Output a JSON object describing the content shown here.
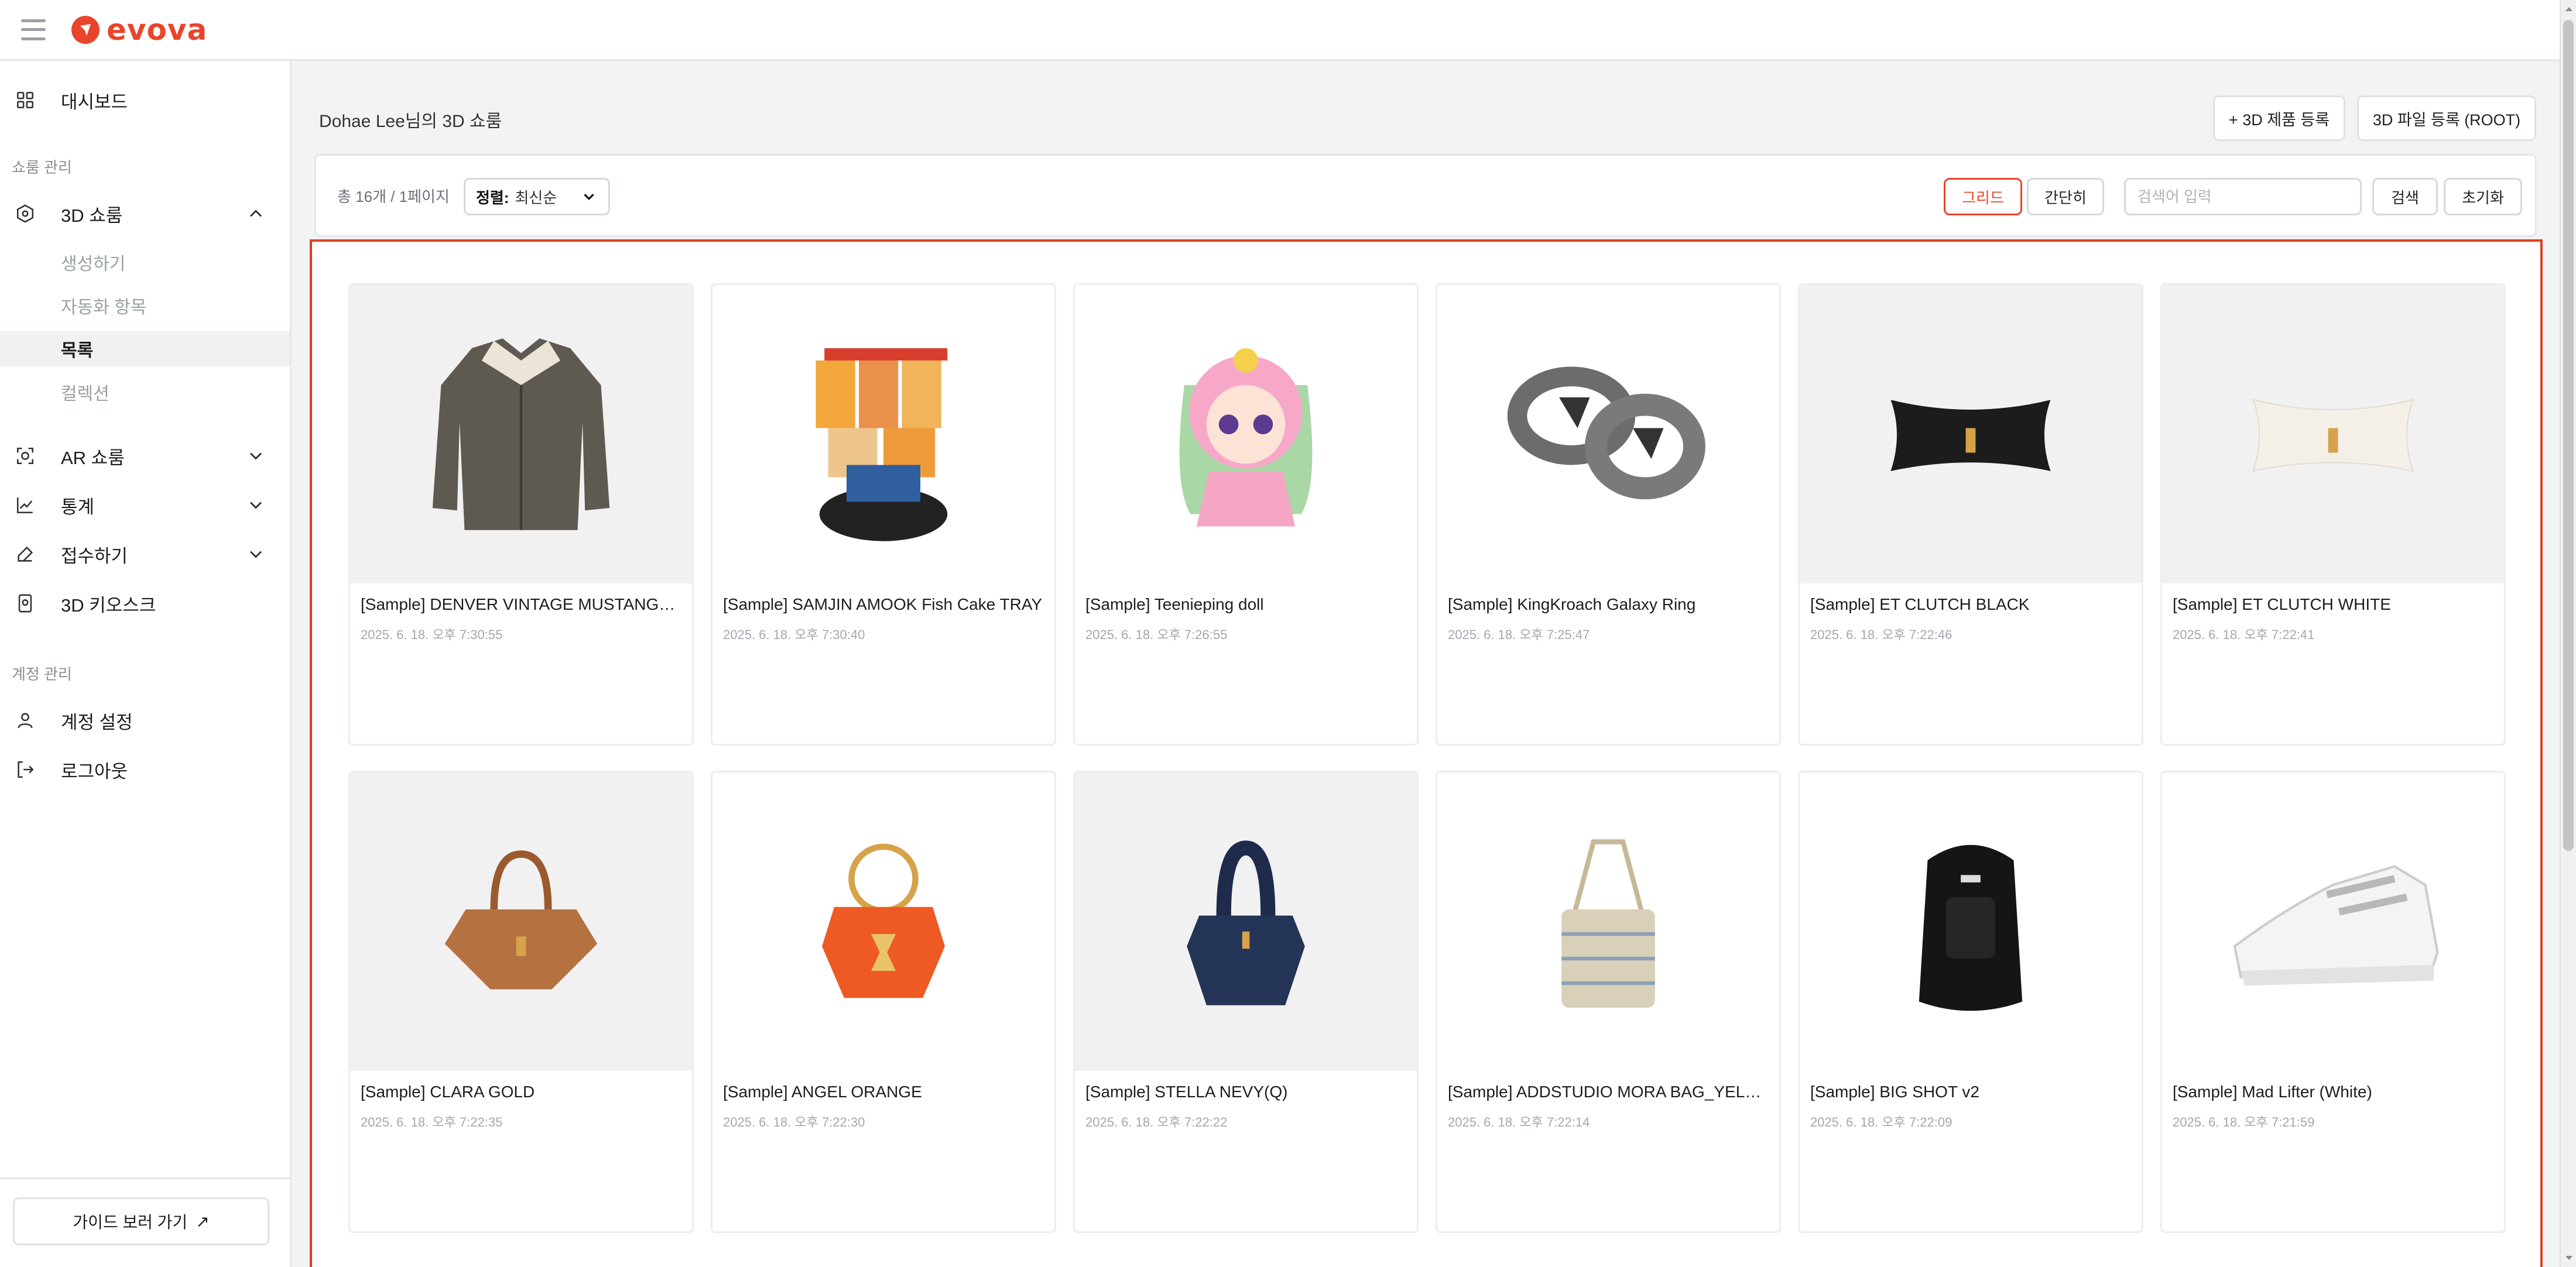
{
  "app": {
    "logo_text": "evova",
    "brand_color": "#e8452c"
  },
  "sidebar": {
    "dashboard_label": "대시보드",
    "shop_section_label": "쇼룸 관리",
    "showroom3d_label": "3D 쇼룸",
    "showroom3d_sub": [
      "생성하기",
      "자동화 항목",
      "목록",
      "컬렉션"
    ],
    "ar_label": "AR 쇼룸",
    "stats_label": "통계",
    "intake_label": "접수하기",
    "kiosk_label": "3D 키오스크",
    "account_section_label": "계정 관리",
    "account_settings_label": "계정 설정",
    "logout_label": "로그아웃",
    "guide_label": "가이드 보러 가기",
    "guide_arrow": "↗"
  },
  "header": {
    "title": "Dohae Lee님의 3D 쇼룸",
    "register_product_label": "+ 3D 제품 등록",
    "register_file_label": "3D 파일 등록 (ROOT)"
  },
  "toolbar": {
    "count_text": "총 16개 / 1페이지",
    "sort_key": "정렬:",
    "sort_value": "최신순",
    "grid_label": "그리드",
    "simple_label": "간단히",
    "search_placeholder": "검색어 입력",
    "search_label": "검색",
    "reset_label": "초기화"
  },
  "products": [
    {
      "title": "[Sample] DENVER VINTAGE MUSTANG_BROWN",
      "date": "2025. 6. 18. 오후 7:30:55",
      "icon": "jacket-image"
    },
    {
      "title": "[Sample] SAMJIN AMOOK Fish Cake TRAY",
      "date": "2025. 6. 18. 오후 7:30:40",
      "icon": "fishcake-tray-image"
    },
    {
      "title": "[Sample] Teenieping doll",
      "date": "2025. 6. 18. 오후 7:26:55",
      "icon": "doll-image"
    },
    {
      "title": "[Sample] KingKroach Galaxy Ring",
      "date": "2025. 6. 18. 오후 7:25:47",
      "icon": "ring-image"
    },
    {
      "title": "[Sample] ET CLUTCH BLACK",
      "date": "2025. 6. 18. 오후 7:22:46",
      "icon": "clutch-black-image"
    },
    {
      "title": "[Sample] ET CLUTCH WHITE",
      "date": "2025. 6. 18. 오후 7:22:41",
      "icon": "clutch-white-image"
    },
    {
      "title": "[Sample] CLARA GOLD",
      "date": "2025. 6. 18. 오후 7:22:35",
      "icon": "handbag-brown-image"
    },
    {
      "title": "[Sample] ANGEL ORANGE",
      "date": "2025. 6. 18. 오후 7:22:30",
      "icon": "handbag-orange-image"
    },
    {
      "title": "[Sample] STELLA NEVY(Q)",
      "date": "2025. 6. 18. 오후 7:22:22",
      "icon": "handbag-navy-image"
    },
    {
      "title": "[Sample] ADDSTUDIO MORA BAG_YELLOW",
      "date": "2025. 6. 18. 오후 7:22:14",
      "icon": "shoulder-bag-image"
    },
    {
      "title": "[Sample] BIG SHOT v2",
      "date": "2025. 6. 18. 오후 7:22:09",
      "icon": "backpack-image"
    },
    {
      "title": "[Sample] Mad Lifter (White)",
      "date": "2025. 6. 18. 오후 7:21:59",
      "icon": "sneaker-image"
    }
  ]
}
